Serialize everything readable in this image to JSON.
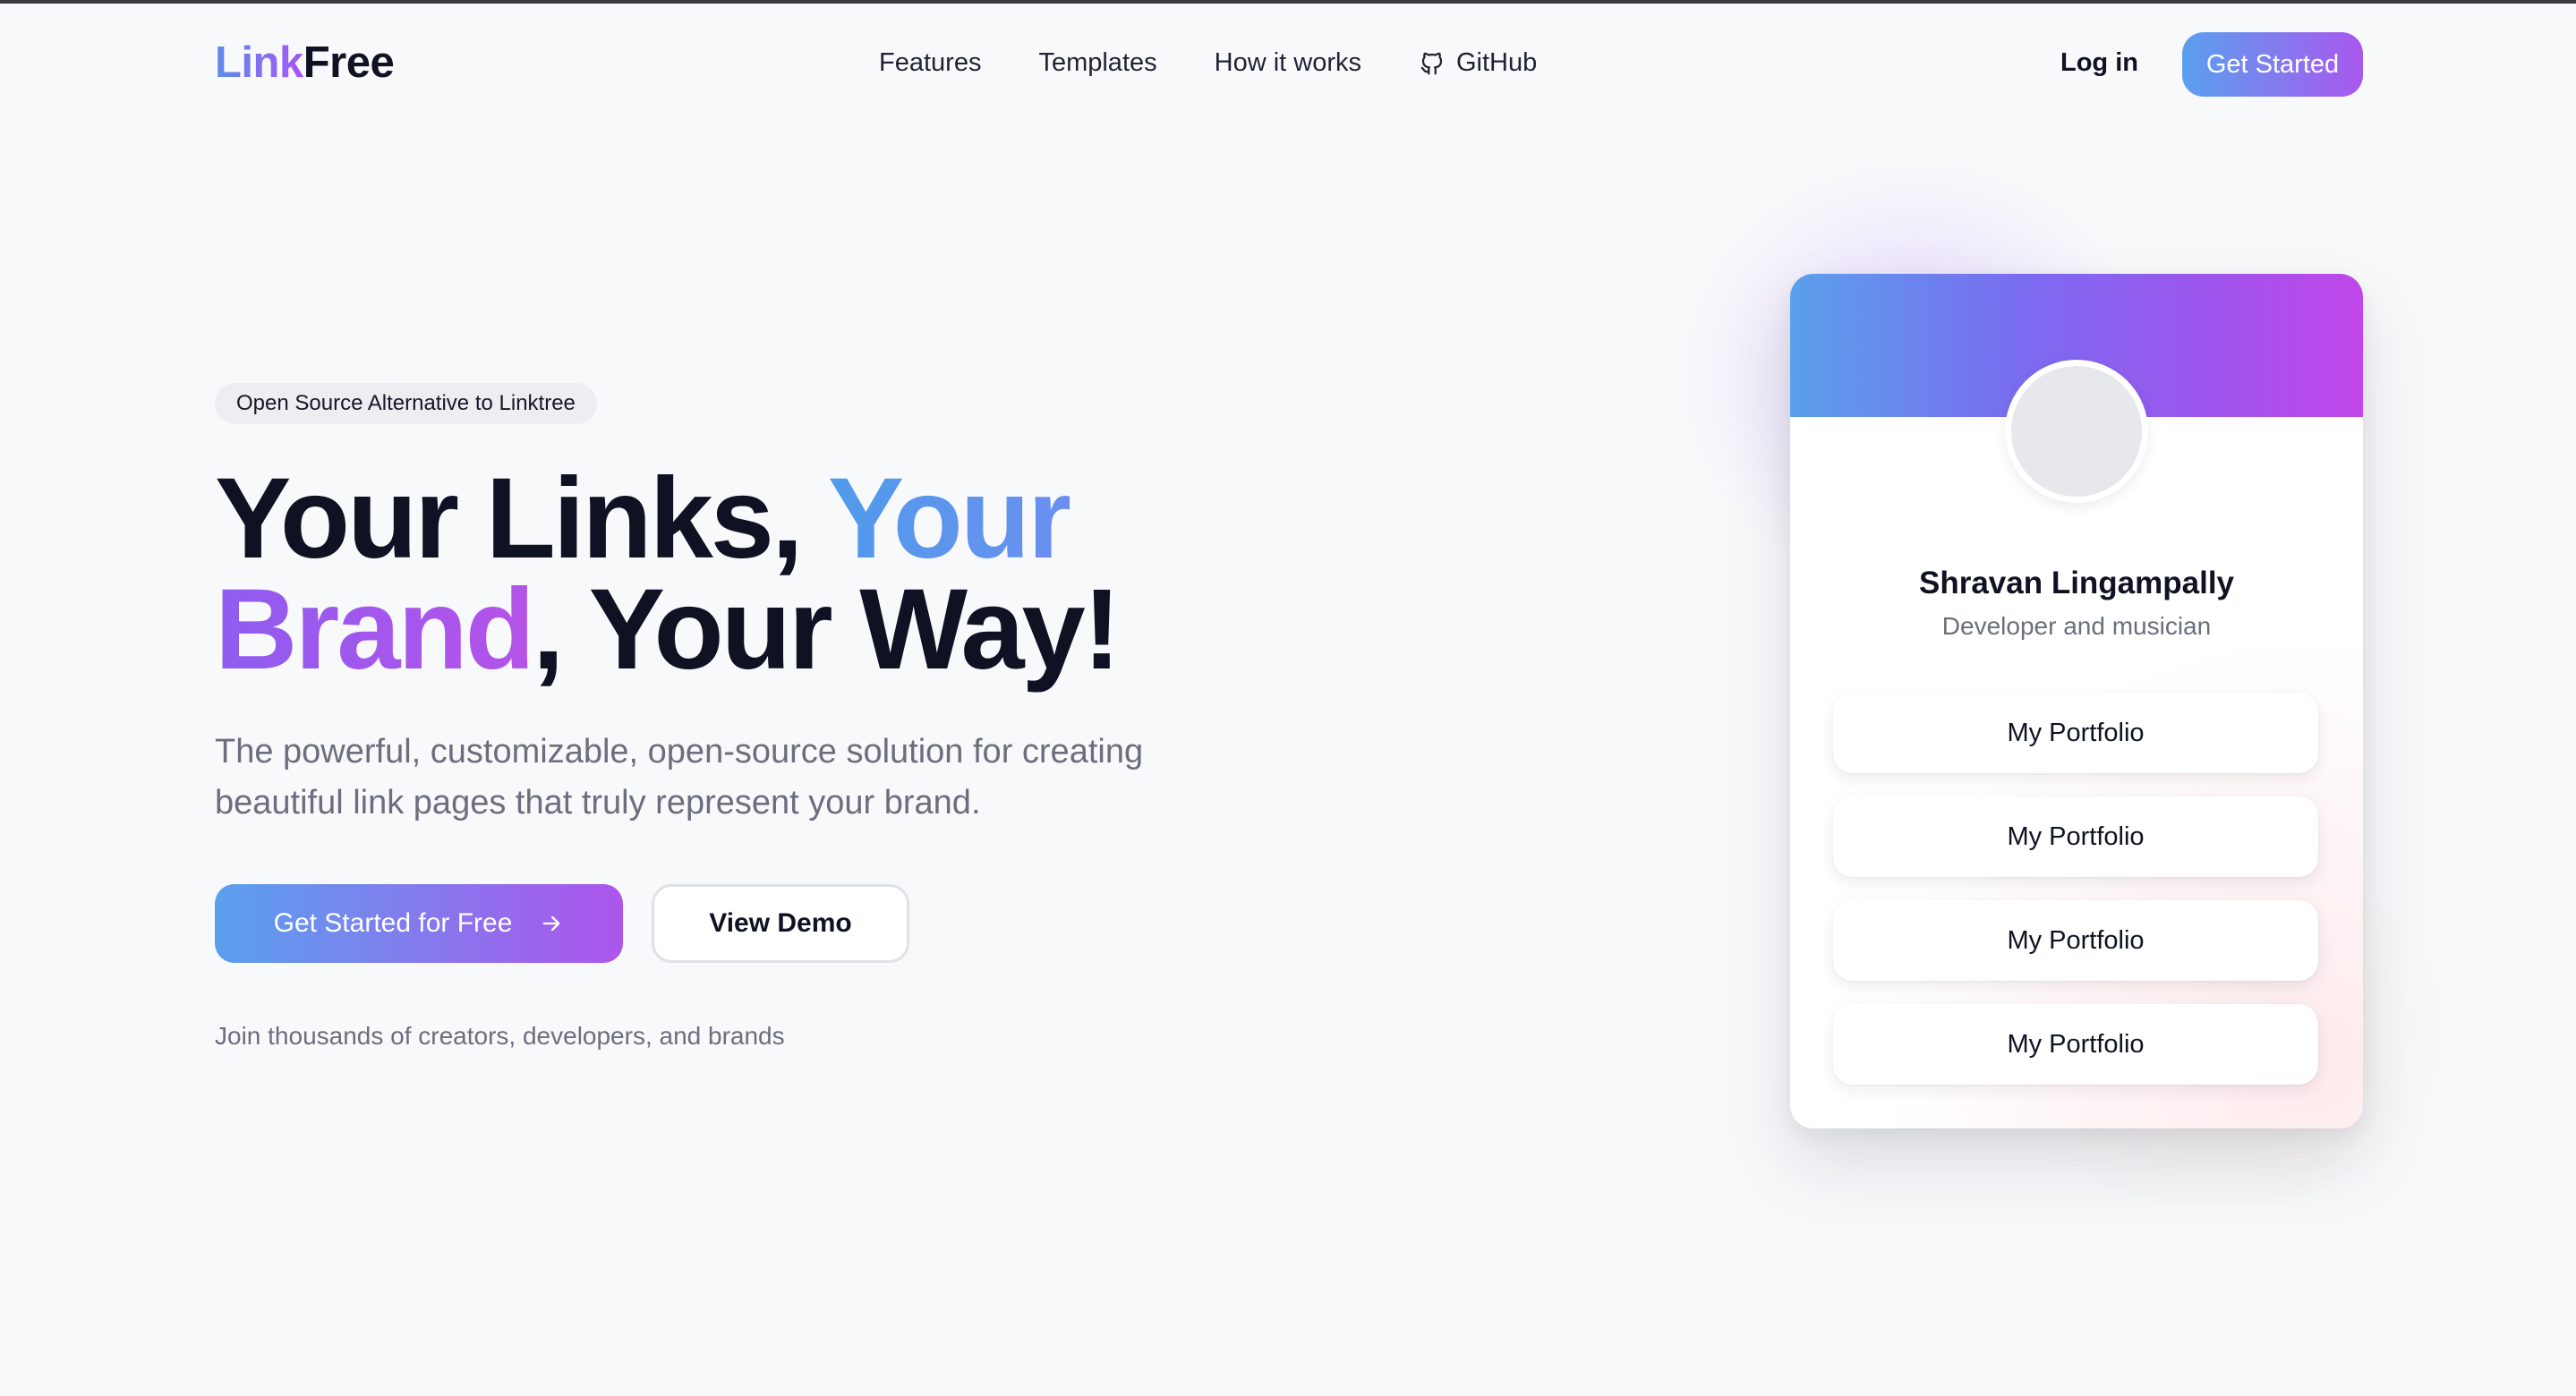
{
  "nav": {
    "logo_part1": "Link",
    "logo_part2": "Free",
    "links": [
      "Features",
      "Templates",
      "How it works",
      "GitHub"
    ],
    "login": "Log in",
    "cta": "Get Started"
  },
  "hero": {
    "badge": "Open Source Alternative to Linktree",
    "headline": {
      "part1": "Your Links, ",
      "part2": "Your",
      "part3": "Brand",
      "part4": ", Your Way!"
    },
    "subtitle": "The powerful, customizable, open-source solution for creating beautiful link pages that truly represent your brand.",
    "primary_cta": "Get Started for Free",
    "secondary_cta": "View Demo",
    "social_proof": "Join thousands of creators, developers, and brands"
  },
  "preview_card": {
    "name": "Shravan Lingampally",
    "bio": "Developer and musician",
    "links": [
      "My Portfolio",
      "My Portfolio",
      "My Portfolio",
      "My Portfolio"
    ]
  },
  "icons": {
    "github": "github-icon",
    "arrow": "arrow-right-icon",
    "avatar": "avatar-placeholder"
  },
  "colors": {
    "gradient_start": "#5aa0ee",
    "gradient_end": "#ad55ec",
    "text_dark": "#0f1222",
    "text_muted": "#6b6f7d",
    "background": "#f8f9fb"
  }
}
